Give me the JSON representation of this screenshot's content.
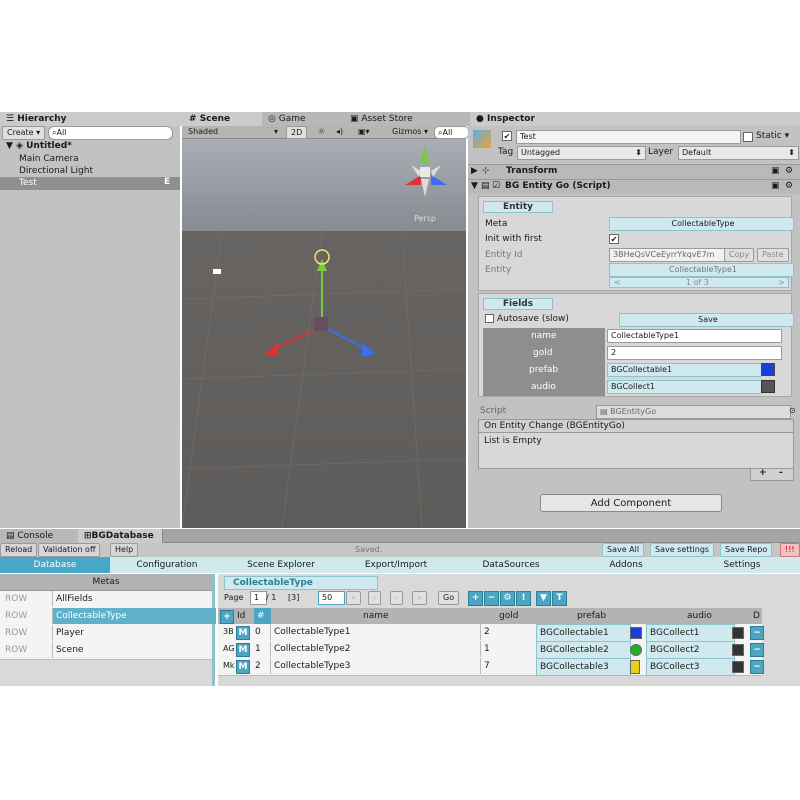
{
  "hierarchy": {
    "tab": "Hierarchy",
    "create_label": "Create",
    "search_placeholder": "All",
    "scene": "Untitled*",
    "items": [
      "Main Camera",
      "Directional Light",
      "Test"
    ],
    "badge": "E"
  },
  "scene_view": {
    "tabs": [
      "Scene",
      "Game",
      "Asset Store"
    ],
    "shading": "Shaded",
    "mode_2d": "2D",
    "gizmos": "Gizmos",
    "search_placeholder": "All",
    "persp": "Persp"
  },
  "inspector": {
    "tab": "Inspector",
    "object_name": "Test",
    "static_label": "Static",
    "tag_label": "Tag",
    "tag_value": "Untagged",
    "layer_label": "Layer",
    "layer_value": "Default",
    "transform_label": "Transform",
    "component_label": "BG Entity Go (Script)",
    "entity_section": "Entity",
    "meta_label": "Meta",
    "meta_value": "CollectableType",
    "init_label": "Init with first",
    "entity_id_label": "Entity Id",
    "entity_id_value": "3BHeQsVCeEyrrYkqvE7m",
    "copy_label": "Copy",
    "paste_label": "Paste",
    "entity_label": "Entity",
    "entity_value": "CollectableType1",
    "pager": "1 of 3",
    "fields_section": "Fields",
    "autosave_label": "Autosave (slow)",
    "save_label": "Save",
    "fields": [
      {
        "name": "name",
        "value": "CollectableType1"
      },
      {
        "name": "gold",
        "value": "2"
      },
      {
        "name": "prefab",
        "value": "BGCollectable1"
      },
      {
        "name": "audio",
        "value": "BGCollect1"
      }
    ],
    "script_label": "Script",
    "script_value": "BGEntityGo",
    "event_label": "On Entity Change (BGEntityGo)",
    "list_empty": "List is Empty",
    "add_component": "Add Component"
  },
  "bottom": {
    "tabs": [
      "Console",
      "BGDatabase"
    ],
    "toolbar": [
      "Reload",
      "Validation off",
      "Help"
    ],
    "status": "Saved.",
    "right_buttons": [
      "Save All",
      "Save settings",
      "Save Repo",
      "!!!"
    ],
    "nav": [
      "Database",
      "Configuration",
      "Scene Explorer",
      "Export/Import",
      "DataSources",
      "Addons",
      "Settings"
    ],
    "metas_header": "Metas",
    "metas": [
      {
        "tag": "ROW",
        "name": "AllFields"
      },
      {
        "tag": "ROW",
        "name": "CollectableType"
      },
      {
        "tag": "ROW",
        "name": "Player"
      },
      {
        "tag": "ROW",
        "name": "Scene"
      }
    ],
    "table_tab": "CollectableType",
    "page_label": "Page",
    "page_value": "1",
    "page_of": "/ 1",
    "page_count": "[3]",
    "page_size": "50",
    "go_label": "Go",
    "columns": [
      "Id",
      "#",
      "name",
      "gold",
      "prefab",
      "audio",
      "D"
    ],
    "rows": [
      {
        "id": "3B",
        "m": "M",
        "num": "0",
        "name": "CollectableType1",
        "gold": "2",
        "prefab": "BGCollectable1",
        "audio": "BGCollect1",
        "color": "#1a3fd6"
      },
      {
        "id": "AG",
        "m": "M",
        "num": "1",
        "name": "CollectableType2",
        "gold": "1",
        "prefab": "BGCollectable2",
        "audio": "BGCollect2",
        "color": "#22b022"
      },
      {
        "id": "Mk",
        "m": "M",
        "num": "2",
        "name": "CollectableType3",
        "gold": "7",
        "prefab": "BGCollectable3",
        "audio": "BGCollect3",
        "color": "#e6d21a"
      }
    ]
  }
}
